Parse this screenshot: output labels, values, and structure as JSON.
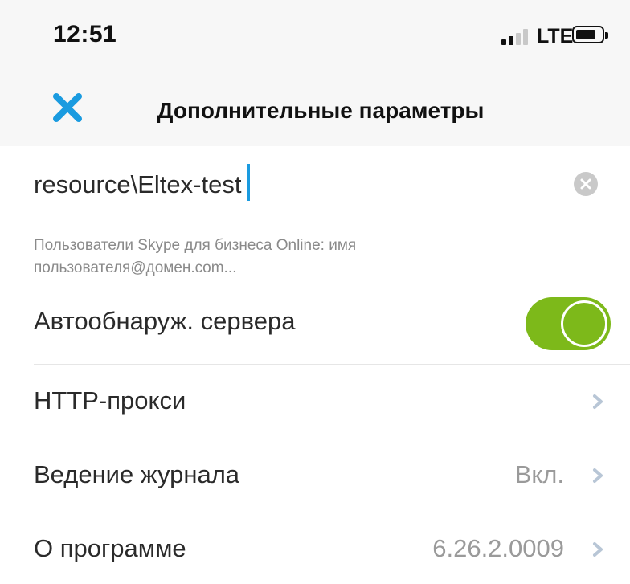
{
  "status_bar": {
    "time": "12:51",
    "network": "LTE"
  },
  "nav": {
    "title": "Дополнительные параметры",
    "close_icon": "close-icon"
  },
  "server": {
    "value": "resource\\Eltex-test",
    "clear_icon": "clear-icon"
  },
  "hint": "Пользователи Skype для бизнеса Online: имя пользователя@домен.com...",
  "settings": [
    {
      "label": "Автообнаруж. сервера",
      "type": "toggle",
      "on": true
    },
    {
      "label": "HTTP-прокси",
      "type": "link",
      "value": ""
    },
    {
      "label": "Ведение журнала",
      "type": "link",
      "value": "Вкл."
    },
    {
      "label": "О программе",
      "type": "link",
      "value": "6.26.2.0009"
    }
  ],
  "colors": {
    "accent": "#1a9be0",
    "toggle_on": "#7db91a"
  }
}
